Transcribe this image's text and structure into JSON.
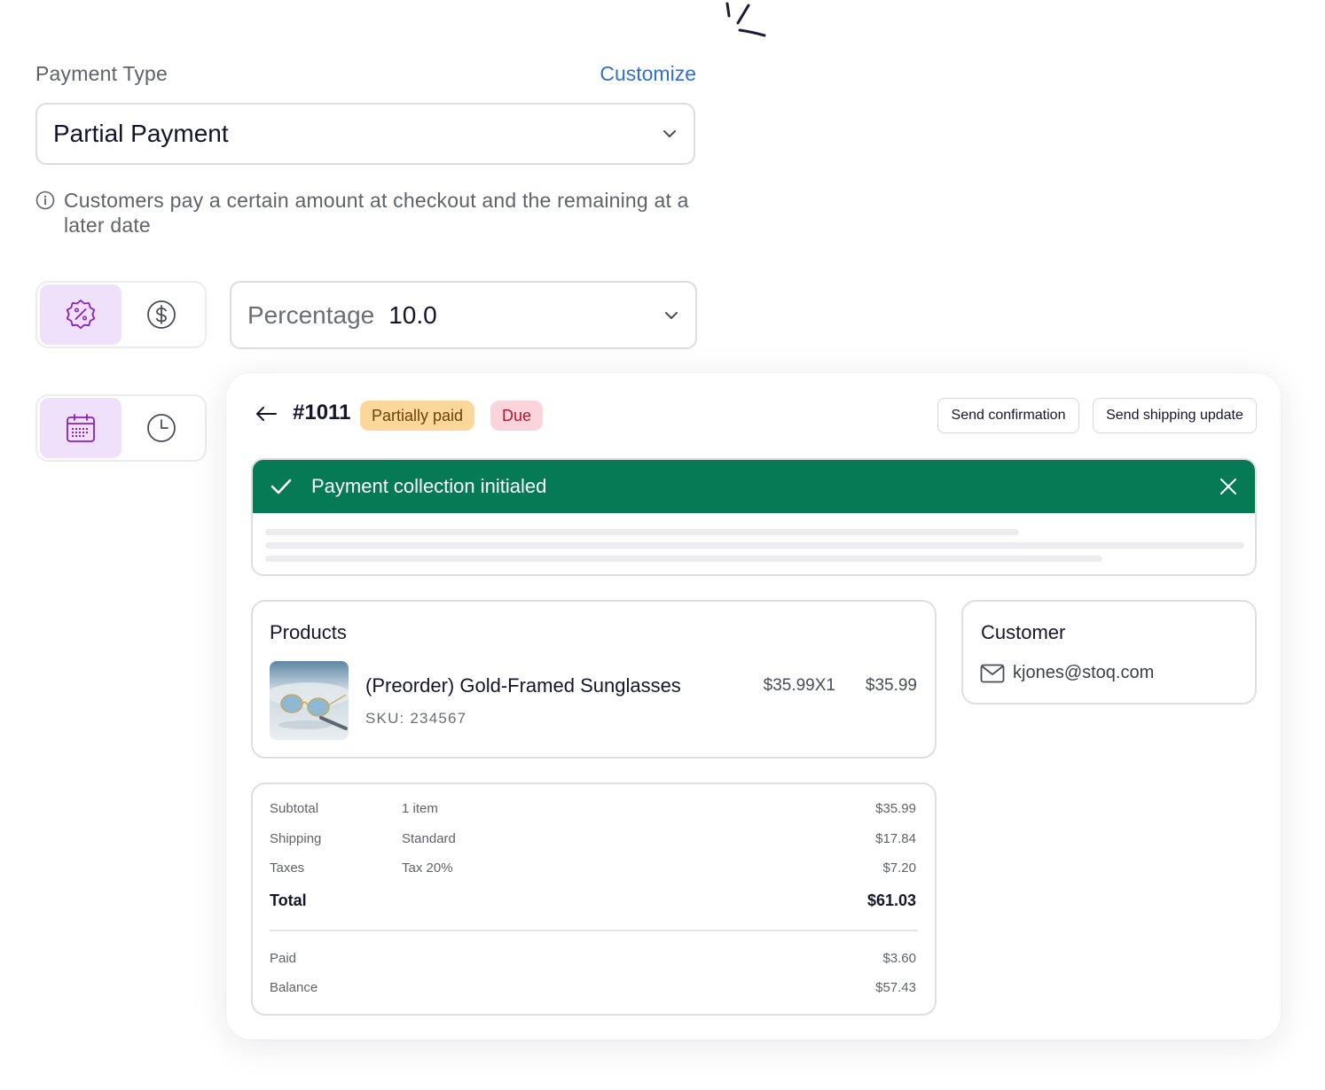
{
  "payment_type": {
    "label": "Payment Type",
    "customize_label": "Customize",
    "selected": "Partial Payment",
    "info_text": "Customers pay a certain amount at checkout and the remaining at a later date"
  },
  "amount": {
    "mode_label": "Percentage",
    "value": "10.0",
    "mode_options": [
      "percent-badge-icon",
      "dollar-circle-icon"
    ],
    "active_mode": "percent-badge-icon"
  },
  "schedule": {
    "options": [
      "calendar-icon",
      "clock-icon"
    ],
    "active": "calendar-icon"
  },
  "order": {
    "id": "#1011",
    "badges": {
      "partially_paid": "Partially paid",
      "due": "Due"
    },
    "actions": {
      "send_confirmation": "Send confirmation",
      "send_shipping_update": "Send shipping update"
    },
    "banner": {
      "title": "Payment collection initialed"
    },
    "products": {
      "title": "Products",
      "items": [
        {
          "name": "(Preorder) Gold-Framed Sunglasses",
          "sku": "SKU: 234567",
          "unit": "$35.99X1",
          "total": "$35.99"
        }
      ]
    },
    "customer": {
      "title": "Customer",
      "email": "kjones@stoq.com"
    },
    "totals": {
      "subtotal": {
        "label": "Subtotal",
        "detail": "1 item",
        "amount": "$35.99"
      },
      "shipping": {
        "label": "Shipping",
        "detail": "Standard",
        "amount": "$17.84"
      },
      "taxes": {
        "label": "Taxes",
        "detail": "Tax 20%",
        "amount": "$7.20"
      },
      "total": {
        "label": "Total",
        "amount": "$61.03"
      },
      "paid": {
        "label": "Paid",
        "amount": "$3.60"
      },
      "balance": {
        "label": "Balance",
        "amount": "$57.43"
      }
    }
  },
  "colors": {
    "accent_blue": "#2f6fd6",
    "success_green": "#067a55",
    "active_toggle_bg": "#efe1fb",
    "icon_purple": "#8a1fc4",
    "badge_partial_bg": "#fbd79c",
    "badge_due_bg": "#fbd3db"
  }
}
